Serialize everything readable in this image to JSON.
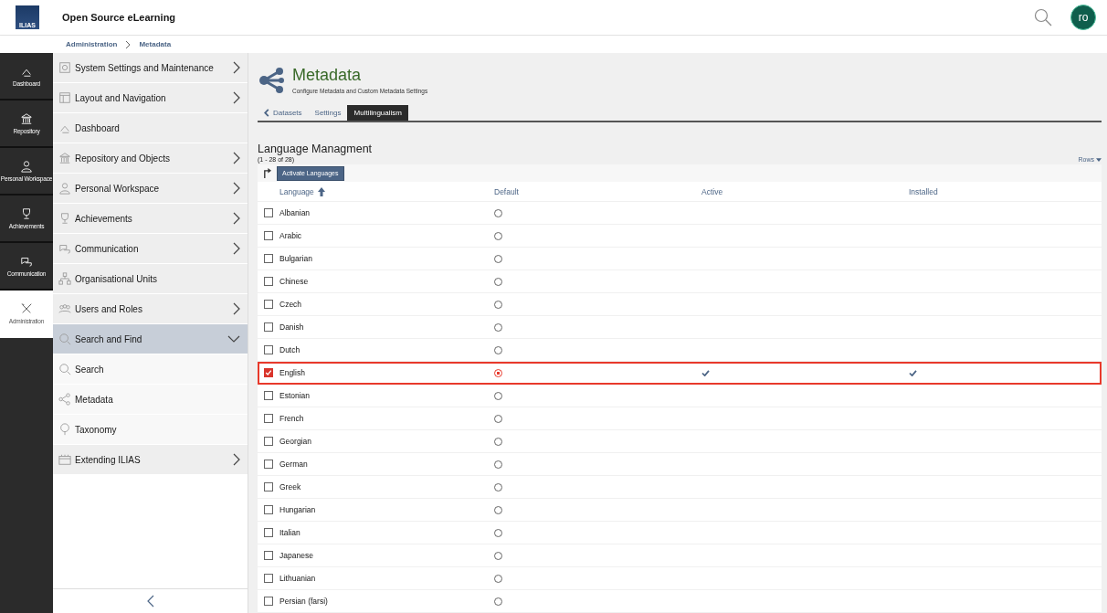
{
  "header": {
    "logo": "ILIAS",
    "title": "Open Source eLearning",
    "avatar": "ro"
  },
  "breadcrumb": [
    "Administration",
    "Metadata"
  ],
  "rail": [
    {
      "label": "Dashboard",
      "selected": false
    },
    {
      "label": "Repository",
      "selected": false
    },
    {
      "label": "Personal Workspace",
      "selected": false
    },
    {
      "label": "Achievements",
      "selected": false
    },
    {
      "label": "Communication",
      "selected": false
    },
    {
      "label": "Administration",
      "selected": true
    }
  ],
  "sidebar": {
    "items": [
      {
        "label": "System Settings and Maintenance",
        "expandable": true,
        "expanded": false,
        "selected": false
      },
      {
        "label": "Layout and Navigation",
        "expandable": true,
        "expanded": false,
        "selected": false
      },
      {
        "label": "Dashboard",
        "expandable": false,
        "expanded": false,
        "selected": false
      },
      {
        "label": "Repository and Objects",
        "expandable": true,
        "expanded": false,
        "selected": false
      },
      {
        "label": "Personal Workspace",
        "expandable": true,
        "expanded": false,
        "selected": false
      },
      {
        "label": "Achievements",
        "expandable": true,
        "expanded": false,
        "selected": false
      },
      {
        "label": "Communication",
        "expandable": true,
        "expanded": false,
        "selected": false
      },
      {
        "label": "Organisational Units",
        "expandable": false,
        "expanded": false,
        "selected": false
      },
      {
        "label": "Users and Roles",
        "expandable": true,
        "expanded": false,
        "selected": false
      },
      {
        "label": "Search and Find",
        "expandable": true,
        "expanded": true,
        "selected": true,
        "children": [
          {
            "label": "Search",
            "selected": false
          },
          {
            "label": "Metadata",
            "selected": false
          },
          {
            "label": "Taxonomy",
            "selected": false
          }
        ]
      },
      {
        "label": "Extending ILIAS",
        "expandable": true,
        "expanded": false,
        "selected": false
      }
    ]
  },
  "page": {
    "title": "Metadata",
    "subtitle": "Configure Metadata and Custom Metadata Settings",
    "tabs": [
      {
        "label": "Datasets",
        "kind": "back",
        "selected": false
      },
      {
        "label": "Settings",
        "kind": "tab",
        "selected": false
      },
      {
        "label": "Multilingualism",
        "kind": "tab",
        "selected": true
      }
    ]
  },
  "table": {
    "title": "Language Managment",
    "count": "(1 - 28 of 28)",
    "rows_control": "Rows",
    "action": "Activate Languages",
    "columns": [
      {
        "label": "Language",
        "sorted": true
      },
      {
        "label": "Default",
        "sorted": false
      },
      {
        "label": "Active",
        "sorted": false
      },
      {
        "label": "Installed",
        "sorted": false
      }
    ],
    "rows": [
      {
        "language": "Albanian",
        "checked": false,
        "default": false,
        "active": false,
        "installed": false,
        "highlighted": false
      },
      {
        "language": "Arabic",
        "checked": false,
        "default": false,
        "active": false,
        "installed": false,
        "highlighted": false
      },
      {
        "language": "Bulgarian",
        "checked": false,
        "default": false,
        "active": false,
        "installed": false,
        "highlighted": false
      },
      {
        "language": "Chinese",
        "checked": false,
        "default": false,
        "active": false,
        "installed": false,
        "highlighted": false
      },
      {
        "language": "Czech",
        "checked": false,
        "default": false,
        "active": false,
        "installed": false,
        "highlighted": false
      },
      {
        "language": "Danish",
        "checked": false,
        "default": false,
        "active": false,
        "installed": false,
        "highlighted": false
      },
      {
        "language": "Dutch",
        "checked": false,
        "default": false,
        "active": false,
        "installed": false,
        "highlighted": false
      },
      {
        "language": "English",
        "checked": true,
        "default": true,
        "active": true,
        "installed": true,
        "highlighted": true
      },
      {
        "language": "Estonian",
        "checked": false,
        "default": false,
        "active": false,
        "installed": false,
        "highlighted": false
      },
      {
        "language": "French",
        "checked": false,
        "default": false,
        "active": false,
        "installed": false,
        "highlighted": false
      },
      {
        "language": "Georgian",
        "checked": false,
        "default": false,
        "active": false,
        "installed": false,
        "highlighted": false
      },
      {
        "language": "German",
        "checked": false,
        "default": false,
        "active": false,
        "installed": false,
        "highlighted": false
      },
      {
        "language": "Greek",
        "checked": false,
        "default": false,
        "active": false,
        "installed": false,
        "highlighted": false
      },
      {
        "language": "Hungarian",
        "checked": false,
        "default": false,
        "active": false,
        "installed": false,
        "highlighted": false
      },
      {
        "language": "Italian",
        "checked": false,
        "default": false,
        "active": false,
        "installed": false,
        "highlighted": false
      },
      {
        "language": "Japanese",
        "checked": false,
        "default": false,
        "active": false,
        "installed": false,
        "highlighted": false
      },
      {
        "language": "Lithuanian",
        "checked": false,
        "default": false,
        "active": false,
        "installed": false,
        "highlighted": false
      },
      {
        "language": "Persian (farsi)",
        "checked": false,
        "default": false,
        "active": false,
        "installed": false,
        "highlighted": false
      }
    ]
  }
}
